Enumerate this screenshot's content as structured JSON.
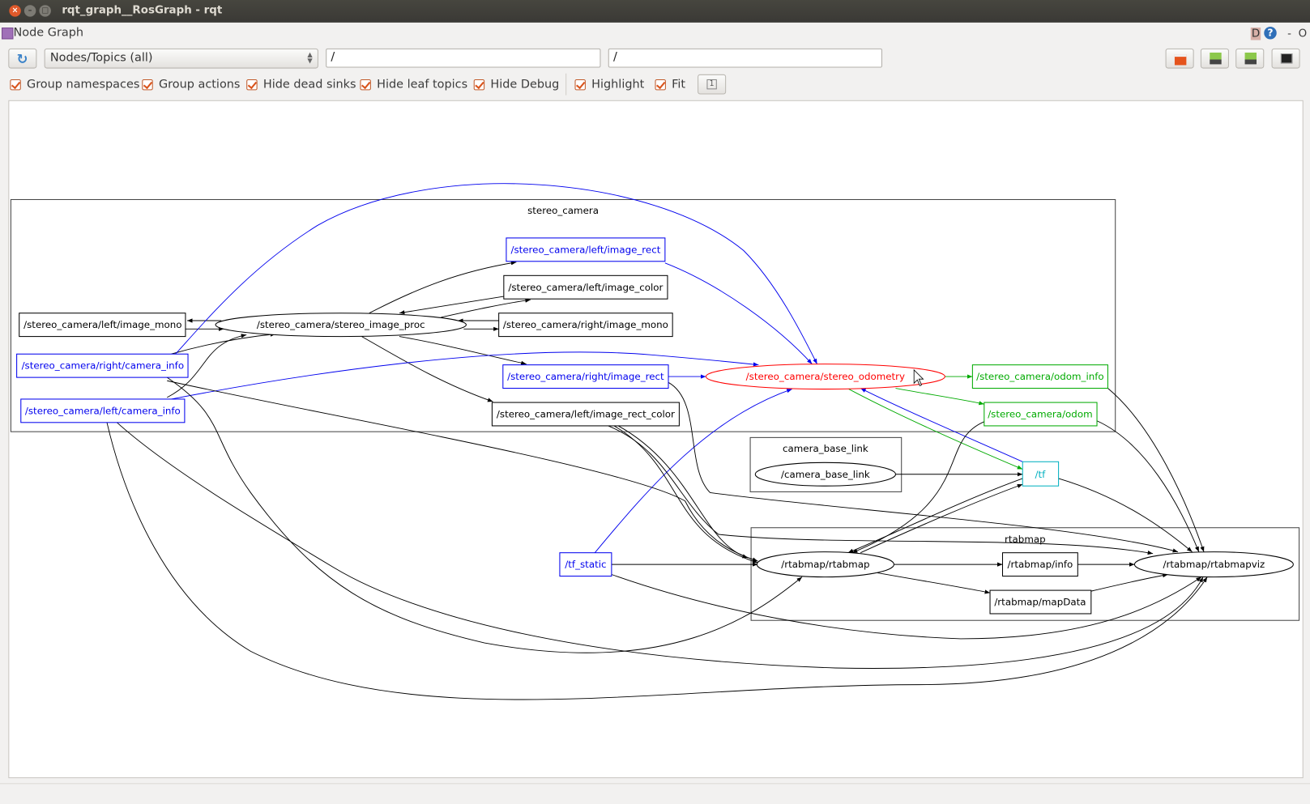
{
  "window": {
    "title": "rqt_graph__RosGraph - rqt"
  },
  "plugin": {
    "title": "Node Graph",
    "help_d": "D",
    "help_q": "?",
    "minimize": "-",
    "close": "O"
  },
  "toolbar": {
    "refresh_icon": "refresh-icon",
    "mode_select": "Nodes/Topics (all)",
    "node_filter": "/",
    "topic_filter": "/",
    "buttons": [
      "load-dot-icon",
      "save-dot-icon",
      "save-svg-icon",
      "screenshot-icon"
    ]
  },
  "options": [
    {
      "label": "Group namespaces",
      "checked": true
    },
    {
      "label": "Group actions",
      "checked": true
    },
    {
      "label": "Hide dead sinks",
      "checked": true
    },
    {
      "label": "Hide leaf topics",
      "checked": true
    },
    {
      "label": "Hide Debug",
      "checked": true
    },
    {
      "label": "Highlight",
      "checked": true
    },
    {
      "label": "Fit",
      "checked": true
    }
  ],
  "fit_button": "1",
  "graph": {
    "clusters": {
      "stereo_camera": "stereo_camera",
      "camera_base_link": "camera_base_link",
      "rtabmap": "rtabmap"
    },
    "nodes": {
      "left_image_mono": "/stereo_camera/left/image_mono",
      "stereo_image_proc": "/stereo_camera/stereo_image_proc",
      "left_image_rect": "/stereo_camera/left/image_rect",
      "left_image_color": "/stereo_camera/left/image_color",
      "right_image_mono": "/stereo_camera/right/image_mono",
      "right_camera_info": "/stereo_camera/right/camera_info",
      "left_camera_info": "/stereo_camera/left/camera_info",
      "right_image_rect": "/stereo_camera/right/image_rect",
      "left_image_rect_color": "/stereo_camera/left/image_rect_color",
      "stereo_odometry": "/stereo_camera/stereo_odometry",
      "odom_info": "/stereo_camera/odom_info",
      "odom": "/stereo_camera/odom",
      "camera_base_link": "/camera_base_link",
      "tf": "/tf",
      "tf_static": "/tf_static",
      "rtabmap": "/rtabmap/rtabmap",
      "rtabmap_info": "/rtabmap/info",
      "rtabmap_mapData": "/rtabmap/mapData",
      "rtabmapviz": "/rtabmap/rtabmapviz"
    },
    "colors": {
      "default": "#000000",
      "highlight_in": "#0000ee",
      "highlight_out": "#00aa00",
      "selected": "#ff0000",
      "both": "#00b0c0"
    }
  }
}
